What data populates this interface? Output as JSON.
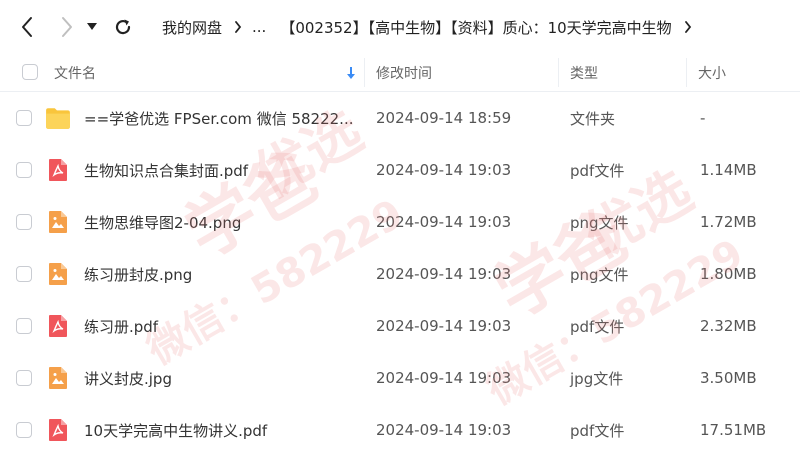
{
  "nav": {
    "back_icon": "chevron-left-icon",
    "forward_icon": "chevron-right-icon",
    "dropdown_icon": "caret-down-icon",
    "refresh_icon": "refresh-icon"
  },
  "breadcrumb": {
    "root": "我的网盘",
    "ellipsis": "...",
    "current": "【002352】【高中生物】【资料】质心：10天学完高中生物"
  },
  "table": {
    "columns": {
      "name": "文件名",
      "modified": "修改时间",
      "type": "类型",
      "size": "大小"
    },
    "sort_icon": "sort-down-arrow-icon",
    "rows": [
      {
        "name": "==学爸优选 FPSer.com 微信 58222...",
        "modified": "2024-09-14 18:59",
        "type": "文件夹",
        "size": "-",
        "icon": "folder-icon"
      },
      {
        "name": "生物知识点合集封面.pdf",
        "modified": "2024-09-14 19:03",
        "type": "pdf文件",
        "size": "1.14MB",
        "icon": "pdf-icon"
      },
      {
        "name": "生物思维导图2-04.png",
        "modified": "2024-09-14 19:03",
        "type": "png文件",
        "size": "1.72MB",
        "icon": "image-icon"
      },
      {
        "name": "练习册封皮.png",
        "modified": "2024-09-14 19:03",
        "type": "png文件",
        "size": "1.80MB",
        "icon": "image-icon"
      },
      {
        "name": "练习册.pdf",
        "modified": "2024-09-14 19:03",
        "type": "pdf文件",
        "size": "2.32MB",
        "icon": "pdf-icon"
      },
      {
        "name": "讲义封皮.jpg",
        "modified": "2024-09-14 19:03",
        "type": "jpg文件",
        "size": "3.50MB",
        "icon": "image-icon"
      },
      {
        "name": "10天学完高中生物讲义.pdf",
        "modified": "2024-09-14 19:03",
        "type": "pdf文件",
        "size": "17.51MB",
        "icon": "pdf-icon"
      }
    ]
  },
  "watermark": {
    "text1": "学爸",
    "text2": "优选",
    "text3": "微信：582229"
  },
  "colors": {
    "pdf": "#f0565b",
    "image": "#f5a04a",
    "folder": "#f9c53c",
    "watermark": "#e87878"
  }
}
